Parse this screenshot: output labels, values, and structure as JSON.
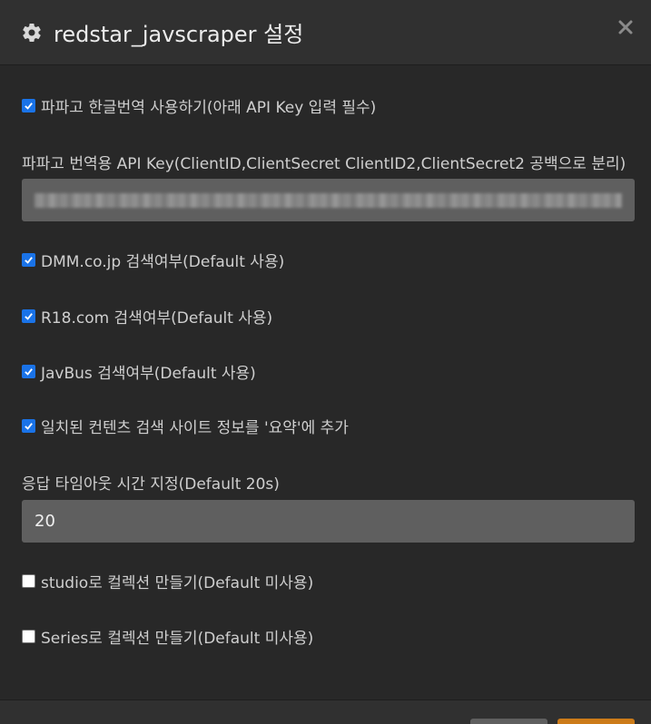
{
  "header": {
    "title": "redstar_javscraper 설정",
    "icon": "gear-icon",
    "close_icon": "close-icon"
  },
  "options": {
    "papago": {
      "label": "파파고 한글번역 사용하기(아래 API Key 입력 필수)",
      "checked": true
    },
    "dmm": {
      "label": "DMM.co.jp 검색여부(Default 사용)",
      "checked": true
    },
    "r18": {
      "label": "R18.com 검색여부(Default 사용)",
      "checked": true
    },
    "javbus": {
      "label": "JavBus 검색여부(Default 사용)",
      "checked": true
    },
    "summary": {
      "label": "일치된 컨텐츠 검색 사이트 정보를 '요약'에 추가",
      "checked": true
    },
    "studio": {
      "label": "studio로 컬렉션 만들기(Default 미사용)",
      "checked": false
    },
    "series": {
      "label": "Series로 컬렉션 만들기(Default 미사용)",
      "checked": false
    }
  },
  "fields": {
    "api_key": {
      "label": "파파고 번역용 API Key(ClientID,ClientSecret ClientID2,ClientSecret2 공백으로 분리)",
      "value_obscured": true
    },
    "timeout": {
      "label": "응답 타임아웃 시간 지정(Default 20s)",
      "value": "20"
    }
  },
  "colors": {
    "accent": "#cc7b19",
    "checkbox": "#1a73e8",
    "background": "#282828",
    "header": "#303030",
    "input": "#5f5f5f"
  }
}
